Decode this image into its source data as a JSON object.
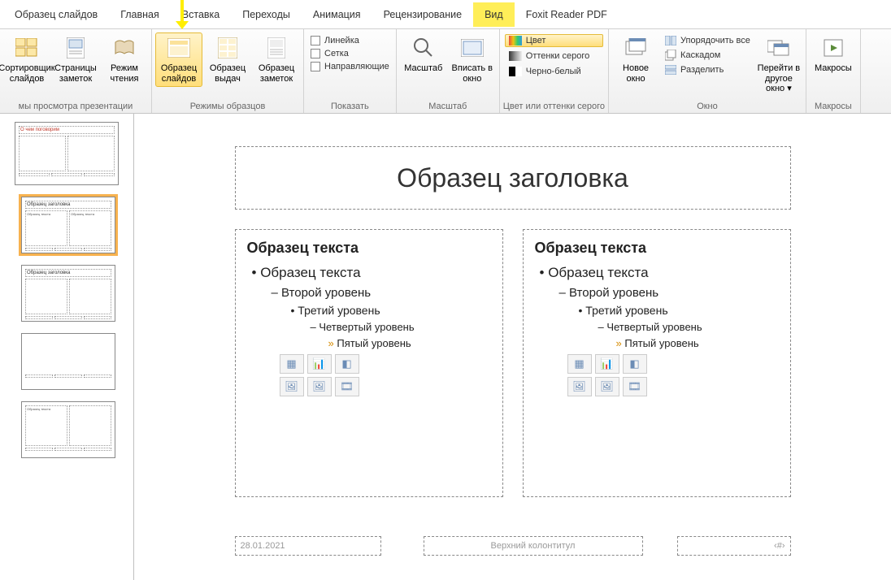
{
  "tabs": [
    "Образец слайдов",
    "Главная",
    "Вставка",
    "Переходы",
    "Анимация",
    "Рецензирование",
    "Вид",
    "Foxit Reader PDF"
  ],
  "active_tab": "Вид",
  "ribbon": {
    "group_views": {
      "label": "мы просмотра презентации",
      "items": [
        "Сортировщик слайдов",
        "Страницы заметок",
        "Режим чтения"
      ]
    },
    "group_masters": {
      "label": "Режимы образцов",
      "items": [
        "Образец слайдов",
        "Образец выдач",
        "Образец заметок"
      ],
      "highlight_index": 0
    },
    "group_show": {
      "label": "Показать",
      "items": [
        "Линейка",
        "Сетка",
        "Направляющие"
      ]
    },
    "group_zoom": {
      "label": "Масштаб",
      "items": [
        "Масштаб",
        "Вписать в окно"
      ]
    },
    "group_color": {
      "label": "Цвет или оттенки серого",
      "items": [
        "Цвет",
        "Оттенки серого",
        "Черно-белый"
      ]
    },
    "group_window": {
      "label": "Окно",
      "big": "Новое окно",
      "small": [
        "Упорядочить все",
        "Каскадом",
        "Разделить"
      ],
      "gotowin": "Перейти в другое окно"
    },
    "group_macros": {
      "label": "Макросы",
      "item": "Макросы"
    }
  },
  "thumbs": {
    "master_title": "О чем поговорим",
    "layout_title": "Образец заголовка",
    "col_text": "Образец текста"
  },
  "slide": {
    "title": "Образец заголовка",
    "body_head": "Образец текста",
    "levels": [
      "Образец текста",
      "Второй уровень",
      "Третий уровень",
      "Четвертый уровень",
      "Пятый уровень"
    ],
    "date": "28.01.2021",
    "footer": "Верхний колонтитул",
    "pagenum": "‹#›"
  }
}
